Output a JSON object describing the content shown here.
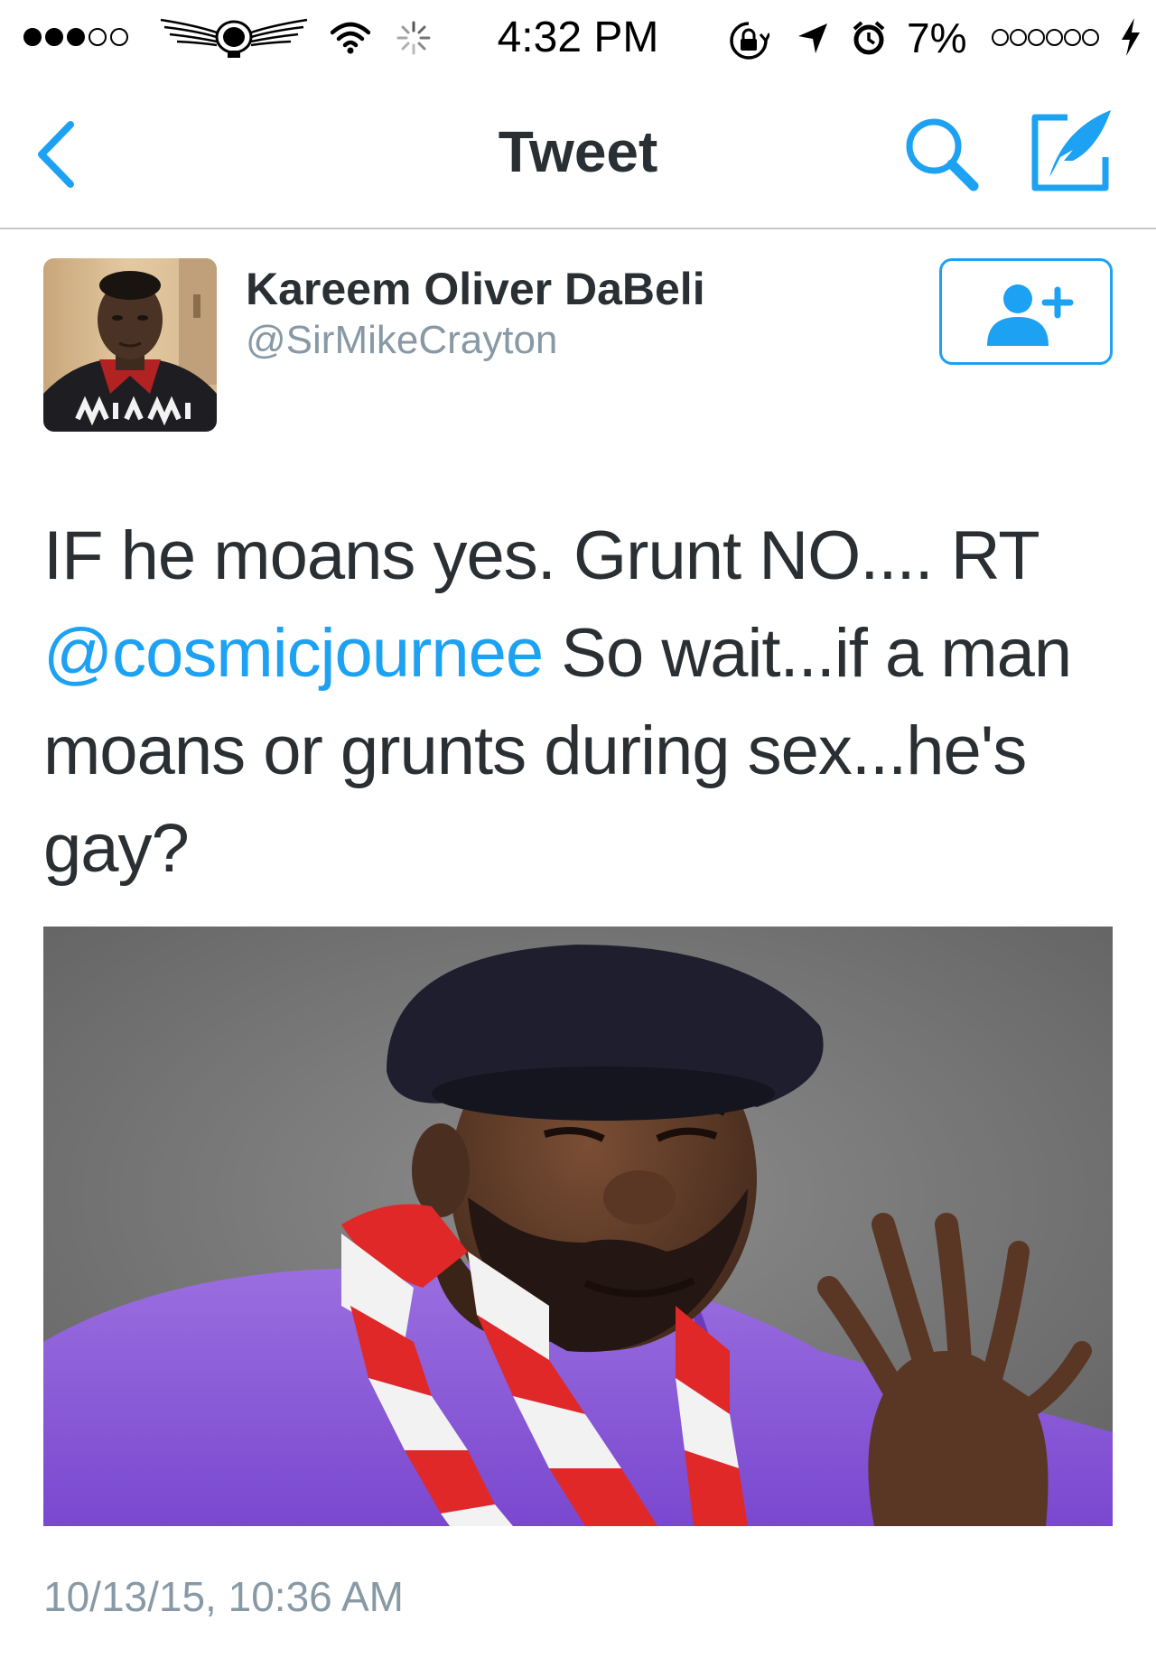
{
  "status_bar": {
    "signal_filled": 3,
    "signal_total": 5,
    "time": "4:32 PM",
    "battery_percent": "7%",
    "battery_dots": 6
  },
  "nav": {
    "title": "Tweet",
    "icons": [
      "chevron-left-icon",
      "search-icon",
      "compose-icon"
    ]
  },
  "tweet": {
    "user": {
      "display_name": "Kareem Oliver DaBeli",
      "handle": "@SirMikeCrayton",
      "avatar_shirt_text": "MIAMI"
    },
    "text_before_mention": "IF he moans yes. Grunt NO.... RT ",
    "mention": "@cosmicjournee",
    "text_after_mention": " So wait...if a man moans or grunts during sex...he's gay?",
    "timestamp": "10/13/15, 10:36 AM"
  },
  "colors": {
    "accent": "#1da1f2",
    "text": "#292f33",
    "secondary_text": "#8899a6",
    "divider": "#c8c8cc"
  }
}
